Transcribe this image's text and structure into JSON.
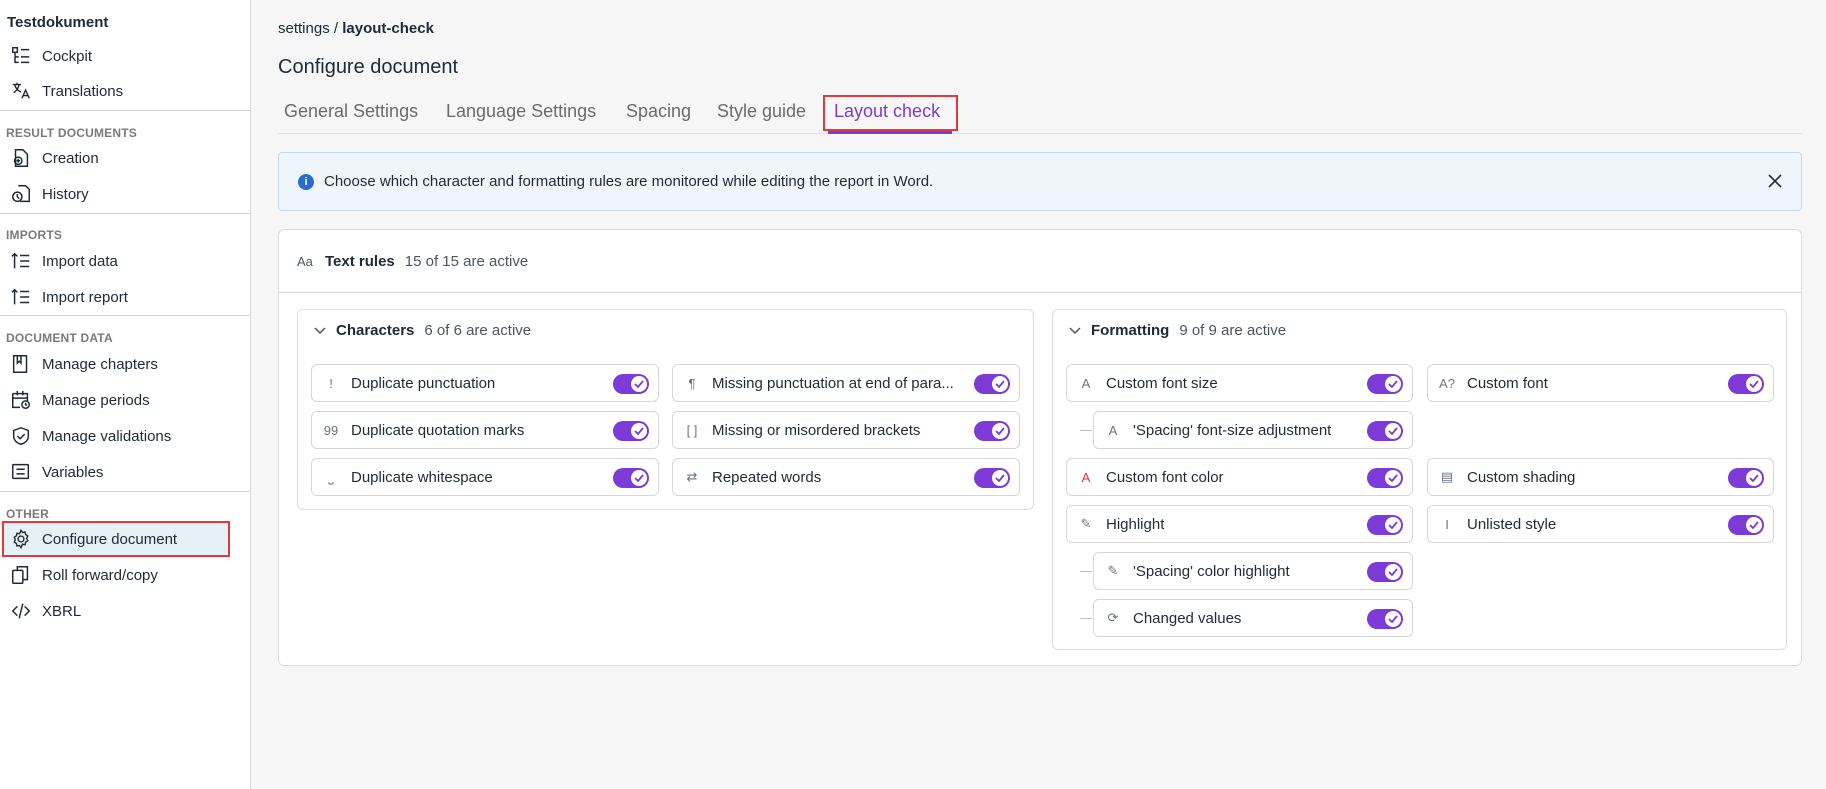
{
  "sidebar": {
    "title": "Testdokument",
    "items_top": [
      {
        "label": "Cockpit",
        "icon": "cockpit-icon"
      },
      {
        "label": "Translations",
        "icon": "translate-icon"
      }
    ],
    "sections": [
      {
        "title": "RESULT DOCUMENTS",
        "items": [
          {
            "label": "Creation"
          },
          {
            "label": "History"
          }
        ]
      },
      {
        "title": "IMPORTS",
        "items": [
          {
            "label": "Import data"
          },
          {
            "label": "Import report"
          }
        ]
      },
      {
        "title": "DOCUMENT DATA",
        "items": [
          {
            "label": "Manage chapters"
          },
          {
            "label": "Manage periods"
          },
          {
            "label": "Manage validations"
          },
          {
            "label": "Variables"
          }
        ]
      },
      {
        "title": "OTHER",
        "items": [
          {
            "label": "Configure document"
          },
          {
            "label": "Roll forward/copy"
          },
          {
            "label": "XBRL"
          }
        ]
      }
    ]
  },
  "breadcrumb": {
    "parent": "settings",
    "sep": " / ",
    "current": "layout-check"
  },
  "page_title": "Configure document",
  "tabs": [
    {
      "label": "General Settings"
    },
    {
      "label": "Language Settings"
    },
    {
      "label": "Spacing"
    },
    {
      "label": "Style guide"
    },
    {
      "label": "Layout check",
      "active": true
    }
  ],
  "info": {
    "message": "Choose which character and formatting rules are monitored while editing the report in Word.",
    "icon": "info-icon"
  },
  "text_rules": {
    "icon_text": "Aa",
    "title": "Text rules",
    "count": "15 of 15 are active",
    "characters": {
      "title": "Characters",
      "count": "6 of 6 are active",
      "rules": [
        {
          "label": "Duplicate punctuation",
          "glyph": "!",
          "enabled": true
        },
        {
          "label": "Missing punctuation at end of para...",
          "glyph": "¶",
          "enabled": true
        },
        {
          "label": "Duplicate quotation marks",
          "glyph": "99",
          "enabled": true
        },
        {
          "label": "Missing or misordered brackets",
          "glyph": "[ ]",
          "enabled": true
        },
        {
          "label": "Duplicate whitespace",
          "glyph": "⎵",
          "enabled": true
        },
        {
          "label": "Repeated words",
          "glyph": "⇄",
          "enabled": true
        }
      ]
    },
    "formatting": {
      "title": "Formatting",
      "count": "9 of 9 are active",
      "rules": [
        {
          "label": "Custom font size",
          "glyph": "A",
          "enabled": true
        },
        {
          "label": "Custom font",
          "glyph": "A?",
          "enabled": true
        },
        {
          "label": "'Spacing' font-size adjustment",
          "glyph": "A",
          "enabled": true
        },
        {
          "label": "Custom font color",
          "glyph": "A",
          "enabled": true
        },
        {
          "label": "Custom shading",
          "glyph": "▤",
          "enabled": true
        },
        {
          "label": "Highlight",
          "glyph": "✎",
          "enabled": true
        },
        {
          "label": "Unlisted style",
          "glyph": "I",
          "enabled": true
        },
        {
          "label": "'Spacing' color highlight",
          "glyph": "✎",
          "enabled": true
        },
        {
          "label": "Changed values",
          "glyph": "⟳",
          "enabled": true
        }
      ]
    }
  },
  "colors": {
    "accent": "#7c3bd6",
    "highlight_box": "#e0383e",
    "info_bg": "#eef5fb"
  }
}
